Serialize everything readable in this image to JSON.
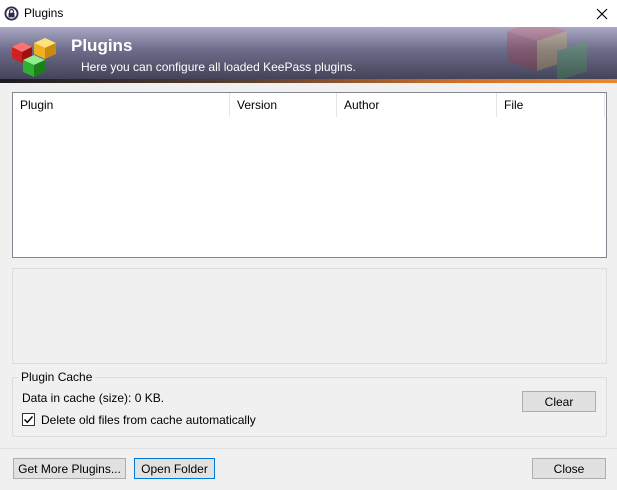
{
  "window": {
    "title": "Plugins",
    "close_glyph": "✕"
  },
  "banner": {
    "heading": "Plugins",
    "subheading": "Here you can configure all loaded KeePass plugins."
  },
  "plugin_list": {
    "columns": [
      "Plugin",
      "Version",
      "Author",
      "File"
    ],
    "rows": []
  },
  "plugin_cache": {
    "group_label": "Plugin Cache",
    "cache_text": "Data in cache (size): 0 KB.",
    "clear_label": "Clear",
    "delete_old_label": "Delete old files from cache automatically",
    "delete_old_checked": true
  },
  "footer": {
    "get_more_label": "Get More Plugins...",
    "open_folder_label": "Open Folder",
    "close_label": "Close"
  },
  "colors": {
    "accent_focus": "#0078d7",
    "banner_orange": "#e88a30"
  },
  "icons": {
    "app": "keepass-lock-icon",
    "logo": "plugin-cubes-icon",
    "close": "close-icon",
    "check": "checkmark-icon"
  }
}
